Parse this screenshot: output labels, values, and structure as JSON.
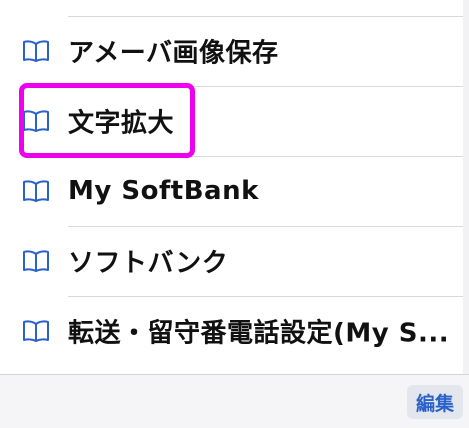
{
  "bookmarks": {
    "items": [
      {
        "label": "アメーバ画像保存",
        "icon": "bookmark-book-icon"
      },
      {
        "label": "文字拡大",
        "icon": "bookmark-book-icon"
      },
      {
        "label": "My SoftBank",
        "icon": "bookmark-book-icon"
      },
      {
        "label": "ソフトバンク",
        "icon": "bookmark-book-icon"
      },
      {
        "label": "転送・留守番電話設定(My S...",
        "icon": "bookmark-book-icon"
      }
    ],
    "highlighted_index": 1
  },
  "toolbar": {
    "edit_label": "編集"
  },
  "colors": {
    "icon_blue": "#2a62c9",
    "highlight_magenta": "#ee00ee",
    "text": "#111111",
    "separator": "#d9d9dc"
  }
}
